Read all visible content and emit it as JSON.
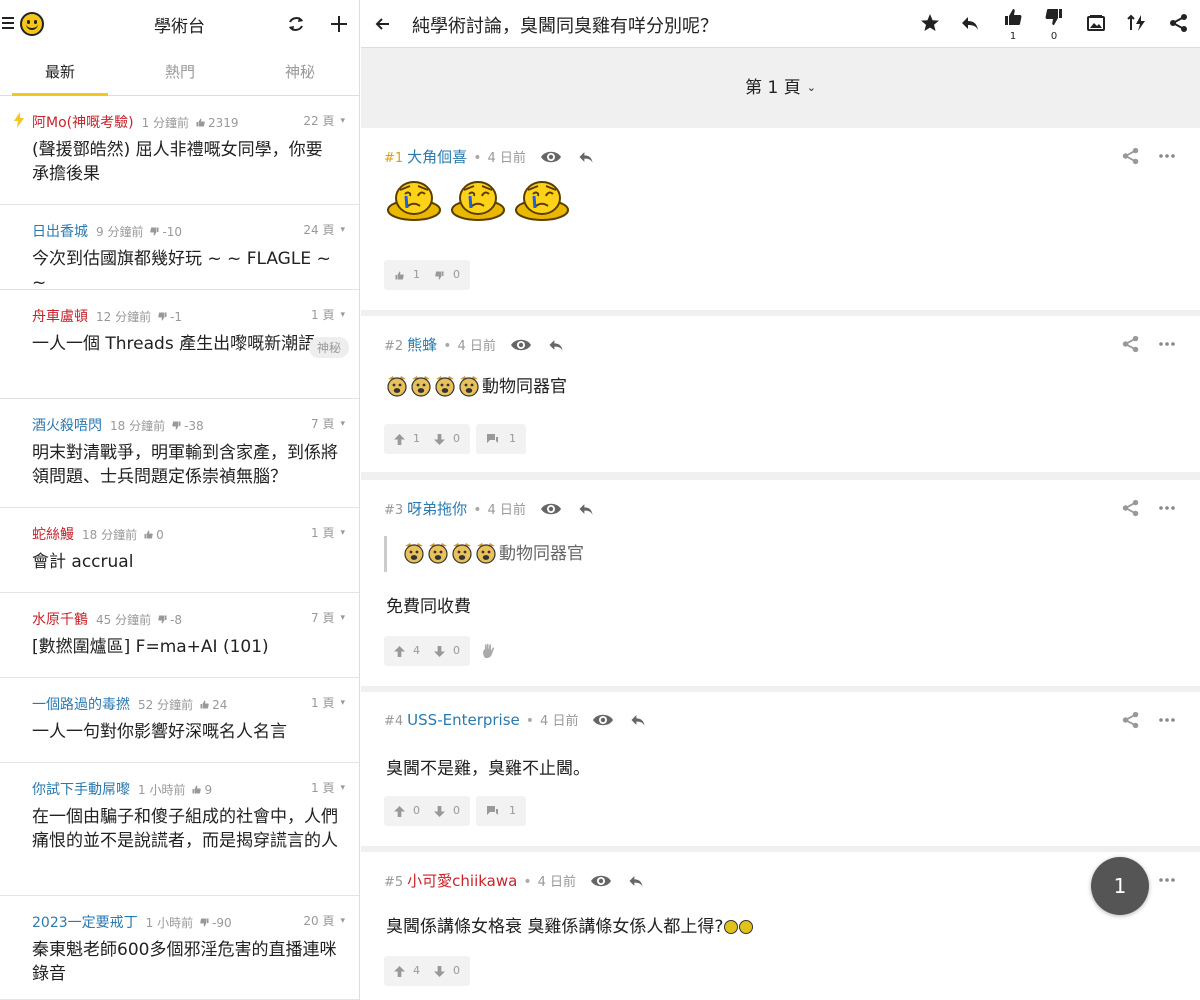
{
  "left": {
    "channel_title": "學術台",
    "tabs": [
      {
        "label": "最新",
        "active": true
      },
      {
        "label": "熱門",
        "active": false
      },
      {
        "label": "神秘",
        "active": false
      }
    ],
    "topics": [
      {
        "user": "阿Mo(神嘅考驗)",
        "user_color": "red",
        "time": "1 分鐘前",
        "vote_type": "up",
        "votes": "2319",
        "pages": "22 頁",
        "title": "(聲援鄧皓然) 屈人非禮嘅女同學，你要承擔後果",
        "hot": true
      },
      {
        "user": "日出香城",
        "user_color": "blue",
        "time": "9 分鐘前",
        "vote_type": "down",
        "votes": "-10",
        "pages": "24 頁",
        "title": "今次到估國旗都幾好玩 ~ ~ FLAGLE ~ ~"
      },
      {
        "user": "舟車盧頓",
        "user_color": "red",
        "time": "12 分鐘前",
        "vote_type": "down",
        "votes": "-1",
        "pages": "1 頁",
        "title": "一人一個 Threads 產生出嚟嘅新潮語",
        "tag": "神秘"
      },
      {
        "user": "酒火殺唔閃",
        "user_color": "blue",
        "time": "18 分鐘前",
        "vote_type": "down",
        "votes": "-38",
        "pages": "7 頁",
        "title": "明末對清戰爭，明軍輸到含家產，到係將領問題、士兵問題定係崇禎無腦？"
      },
      {
        "user": "蛇絲鰻",
        "user_color": "red",
        "time": "18 分鐘前",
        "vote_type": "up",
        "votes": "0",
        "pages": "1 頁",
        "title": "會計 accrual"
      },
      {
        "user": "水原千鶴",
        "user_color": "red",
        "time": "45 分鐘前",
        "vote_type": "down",
        "votes": "-8",
        "pages": "7 頁",
        "title": "[數撚圍爐區] F=ma+AI (101)"
      },
      {
        "user": "一個路過的毒撚",
        "user_color": "blue",
        "time": "52 分鐘前",
        "vote_type": "up",
        "votes": "24",
        "pages": "1 頁",
        "title": "一人一句對你影響好深嘅名人名言"
      },
      {
        "user": "你試下手動屌嚟",
        "user_color": "blue",
        "time": "1 小時前",
        "vote_type": "up",
        "votes": "9",
        "pages": "1 頁",
        "title": "在一個由騙子和傻子組成的社會中，人們痛恨的並不是說謊者，而是揭穿謊言的人"
      },
      {
        "user": "2023一定要戒丁",
        "user_color": "blue",
        "time": "1 小時前",
        "vote_type": "down",
        "votes": "-90",
        "pages": "20 頁",
        "title": "秦東魁老師600多個邪淫危害的直播連咪錄音"
      }
    ]
  },
  "thread": {
    "title": "純學術討論，臭閪同臭雞有咩分別呢？",
    "like_count": "1",
    "dislike_count": "0",
    "page_label": "第 1 頁",
    "posts": [
      {
        "num": "#1",
        "user": "大角佪喜",
        "user_color": "blue",
        "time": "4 日前",
        "up": "1",
        "down": "0"
      },
      {
        "num": "#2",
        "user": "熊蜂",
        "user_color": "blue",
        "time": "4 日前",
        "text": "動物同器官",
        "up": "1",
        "down": "0",
        "replies": "1"
      },
      {
        "num": "#3",
        "user": "呀弟拖你",
        "user_color": "blue",
        "time": "4 日前",
        "quote": "動物同器官",
        "text": "免費同收費",
        "up": "4",
        "down": "0"
      },
      {
        "num": "#4",
        "user": "USS-Enterprise",
        "user_color": "blue",
        "time": "4 日前",
        "text": "臭閪不是雞，臭雞不止閪。",
        "up": "0",
        "down": "0",
        "replies": "1"
      },
      {
        "num": "#5",
        "user": "小可愛chiikawa",
        "user_color": "red",
        "time": "4 日前",
        "text": "臭閪係講條女格衰 臭雞係講條女係人都上得?",
        "up": "4",
        "down": "0"
      }
    ]
  },
  "fab_label": "1",
  "colors": {
    "accent": "#f3c623",
    "red_user": "#c8232c",
    "blue_user": "#2a7ab0",
    "op_number": "#d8a21a"
  }
}
